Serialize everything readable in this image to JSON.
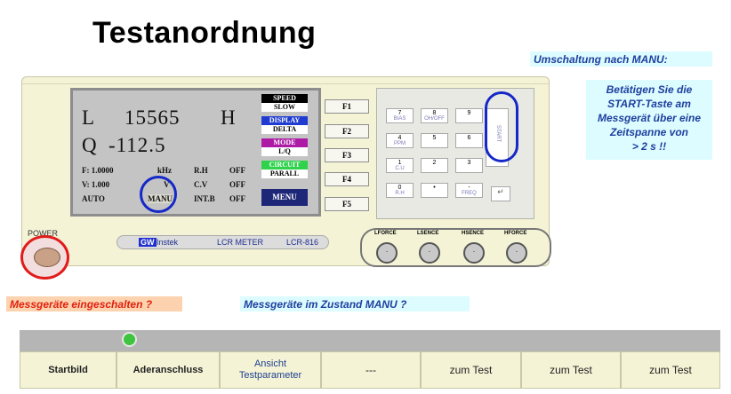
{
  "title": "Testanordnung",
  "notes": {
    "umschaltung": "Umschaltung nach MANU:",
    "start_line1": "Betätigen Sie die",
    "start_line2": "START-Taste am",
    "start_line3": "Messgerät über eine",
    "start_line4": "Zeitspanne von",
    "start_line5": "> 2 s !!",
    "power_question": "Messgeräte eingeschalten ?",
    "manu_question": "Messgeräte im Zustand MANU ?"
  },
  "device": {
    "screen": {
      "line1_param": "L",
      "line1_value": "15565",
      "line1_unit": "H",
      "line2_param": "Q",
      "line2_value": "-112.5",
      "f_label": "F: 1.0000",
      "f_unit": "kHz",
      "rh": "R.H",
      "rh_state": "OFF",
      "v_label": "V: 1.000",
      "v_unit": "V",
      "cv": "C.V",
      "cv_state": "OFF",
      "auto": "AUTO",
      "manu": "MANU",
      "intb": "INT.B",
      "intb_state": "OFF"
    },
    "softkeys": {
      "speed": "SPEED",
      "speed_val": "SLOW",
      "display": "DISPLAY",
      "display_val": "DELTA",
      "mode": "MODE",
      "mode_val": "L/Q",
      "circuit": "CIRCUIT",
      "circuit_val": "PARALL",
      "menu": "MENU"
    },
    "fkeys": [
      "F1",
      "F2",
      "F3",
      "F4",
      "F5"
    ],
    "keypad": [
      {
        "main": "7",
        "sub": "BIAS"
      },
      {
        "main": "8",
        "sub": "OH/OFF"
      },
      {
        "main": "9",
        "sub": ""
      },
      {
        "main": "4",
        "sub": "PPM"
      },
      {
        "main": "5",
        "sub": ""
      },
      {
        "main": "6",
        "sub": ""
      },
      {
        "main": "1",
        "sub": "C.U"
      },
      {
        "main": "2",
        "sub": ""
      },
      {
        "main": "3",
        "sub": ""
      },
      {
        "main": "0",
        "sub": "R.H"
      },
      {
        "main": "•",
        "sub": ""
      },
      {
        "main": "-",
        "sub": "FREQ"
      }
    ],
    "start_key": "START",
    "enter_key": "↵",
    "brand": "GW",
    "brand_rest": "Instek",
    "model_label": "LCR METER",
    "model": "LCR-816",
    "power_label": "POWER",
    "terminals": [
      "LFORCE",
      "LSENCE",
      "HSENCE",
      "HFORCE"
    ]
  },
  "navbar": {
    "startbild": "Startbild",
    "aderanschluss": "Aderanschluss",
    "ansicht_line1": "Ansicht",
    "ansicht_line2": "Testparameter",
    "dashes": "---",
    "zum_test_1": "zum Test",
    "zum_test_2": "zum Test",
    "zum_test_3": "zum Test"
  },
  "colors": {
    "note_blue": "#dcfcff",
    "note_orange": "#fcd3ae",
    "highlight_blue": "#1528c8",
    "highlight_red": "#e11b1b",
    "led_green": "#3ec43e"
  }
}
